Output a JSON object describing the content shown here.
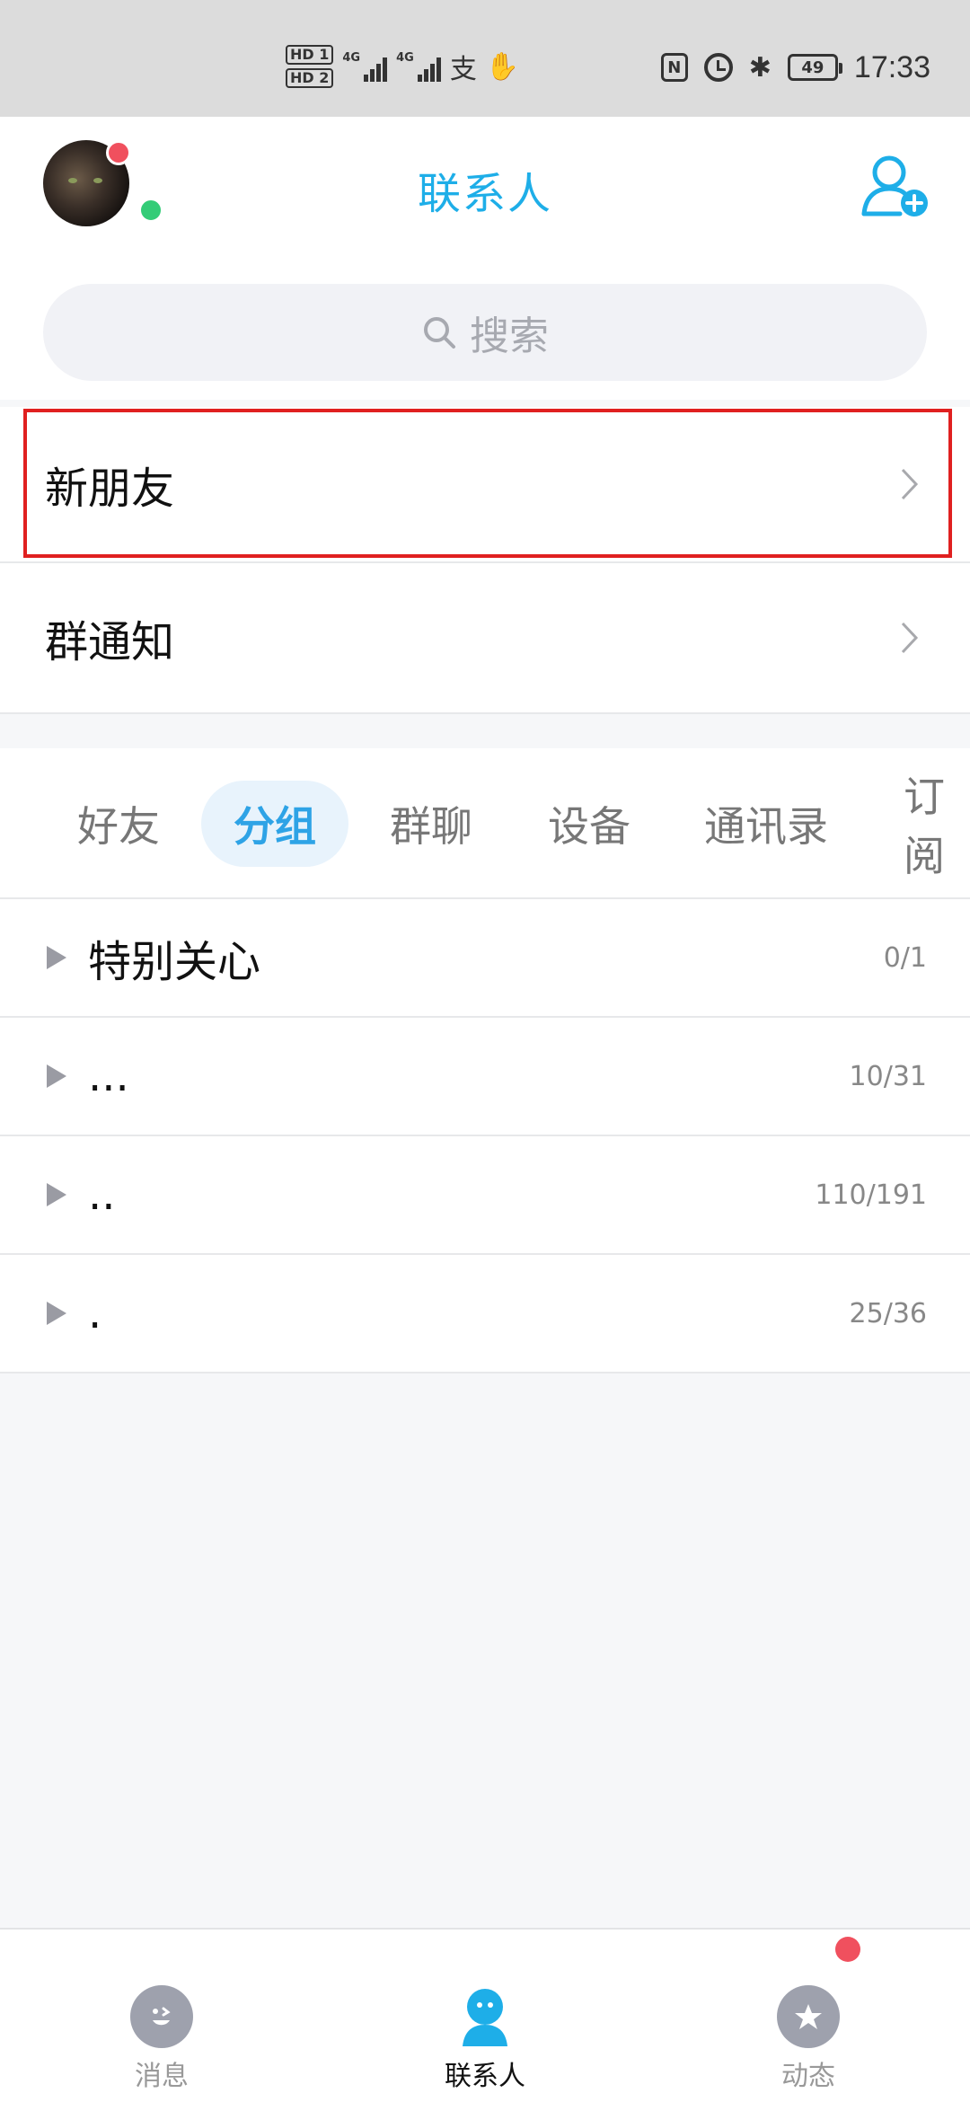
{
  "status_bar": {
    "sim1": "HD 1",
    "sim2": "HD 2",
    "net1": "4G",
    "net2": "4G",
    "time": "17:33",
    "battery": "49",
    "nfc": "N"
  },
  "header": {
    "title": "联系人"
  },
  "search": {
    "placeholder": "搜索"
  },
  "list": {
    "new_friends": "新朋友",
    "group_notice": "群通知"
  },
  "tabs": [
    {
      "label": "好友"
    },
    {
      "label": "分组"
    },
    {
      "label": "群聊"
    },
    {
      "label": "设备"
    },
    {
      "label": "通讯录"
    },
    {
      "label": "订阅"
    }
  ],
  "active_tab": "分组",
  "groups": [
    {
      "name": "特别关心",
      "count": "0/1"
    },
    {
      "name": "...",
      "count": "10/31"
    },
    {
      "name": "..",
      "count": "110/191"
    },
    {
      "name": ".",
      "count": "25/36"
    }
  ],
  "bottom_nav": [
    {
      "label": "消息"
    },
    {
      "label": "联系人"
    },
    {
      "label": "动态"
    }
  ],
  "colors": {
    "accent": "#1eaee8",
    "badge": "#f0505e",
    "online": "#33cc77",
    "highlight": "#e02020"
  }
}
